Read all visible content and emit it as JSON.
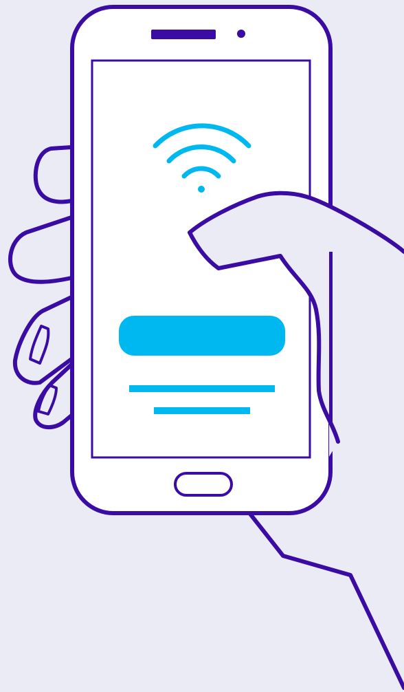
{
  "colors": {
    "background": "#ebebf5",
    "outline": "#3a0ca3",
    "screen": "#ffffff",
    "hand_fill": "#ebebf5",
    "accent": "#00b8f0"
  },
  "icons": {
    "status": "wifi-icon",
    "home": "home-button"
  }
}
